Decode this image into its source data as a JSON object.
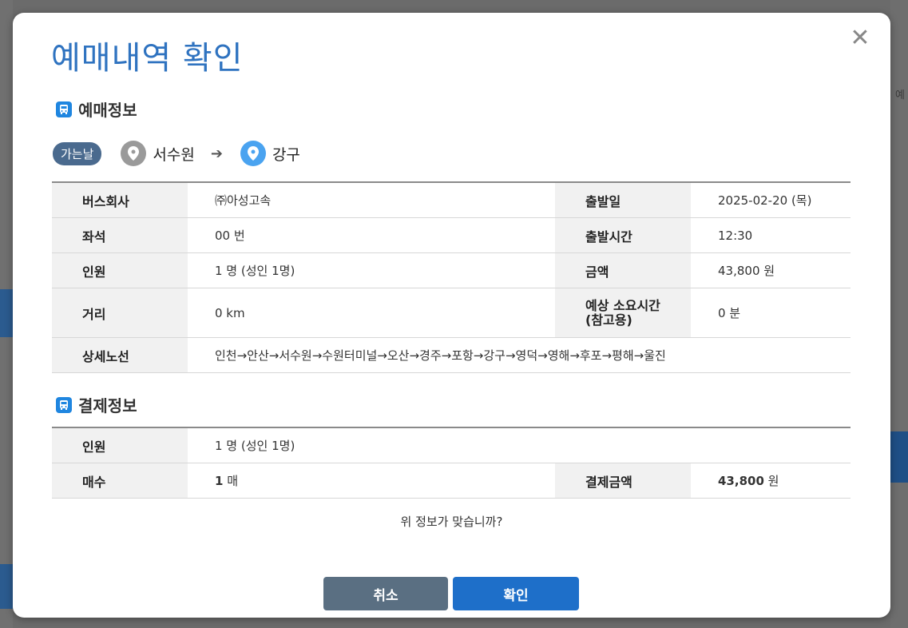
{
  "dialog": {
    "title": "예매내역 확인",
    "close_symbol": "✕"
  },
  "reservation": {
    "section_title": "예매정보",
    "direction_badge": "가는날",
    "origin": "서수원",
    "destination": "강구",
    "rows": [
      {
        "label1": "버스회사",
        "value1": "㈜아성고속",
        "label2": "출발일",
        "value2": "2025-02-20 (목)"
      },
      {
        "label1": "좌석",
        "value1": "00 번",
        "label2": "출발시간",
        "value2": "12:30"
      },
      {
        "label1": "인원",
        "value1": "1 명 (성인 1명)",
        "label2": "금액",
        "value2": "43,800 원"
      },
      {
        "label1": "거리",
        "value1": "0 km",
        "label2": "예상 소요시간\n(참고용)",
        "value2": "0 분"
      }
    ],
    "route_label": "상세노선",
    "route_value": "인천→안산→서수원→수원터미널→오산→경주→포항→강구→영덕→영해→후포→평해→울진"
  },
  "payment": {
    "section_title": "결제정보",
    "people_label": "인원",
    "people_value": "1 명 (성인 1명)",
    "count_label": "매수",
    "count_number": "1",
    "count_unit": "매",
    "amount_label": "결제금액",
    "amount_number": "43,800",
    "amount_unit": "원"
  },
  "confirm_question": "위 정보가 맞습니까?",
  "buttons": {
    "cancel": "취소",
    "ok": "확인"
  },
  "background": {
    "right_text": "예"
  },
  "colors": {
    "title": "#2f73c0",
    "ok_button": "#1e6fc9",
    "cancel_button": "#5a6f82",
    "badge": "#4a6a8e"
  }
}
